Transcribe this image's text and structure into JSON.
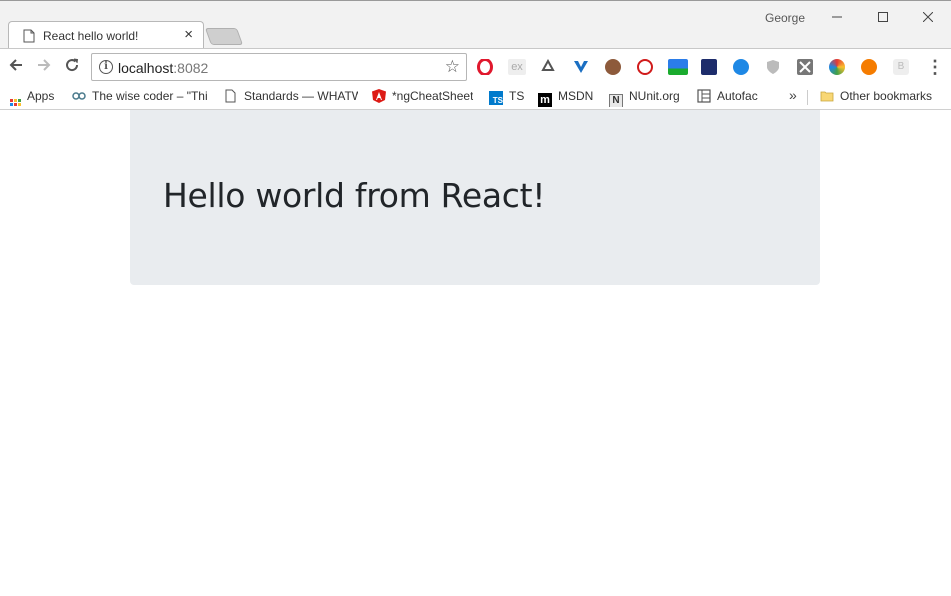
{
  "window": {
    "user_name": "George",
    "minimize": "—",
    "maximize": "☐",
    "close": "✕"
  },
  "tab": {
    "title": "React hello world!",
    "close": "×"
  },
  "toolbar": {
    "back": "←",
    "forward": "→",
    "reload": "⟳",
    "url_host": "localhost",
    "url_port": ":8082",
    "info": "i",
    "star": "☆",
    "menu": "⋮"
  },
  "bookmarks": {
    "items": [
      {
        "label": "Apps",
        "icon": "apps-grid-icon"
      },
      {
        "label": "The wise coder – \"Thi",
        "icon": "owl-icon"
      },
      {
        "label": "Standards — WHATW",
        "icon": "page-icon"
      },
      {
        "label": "*ngCheatSheet",
        "icon": "angular-icon"
      },
      {
        "label": "TS",
        "icon": "typescript-icon"
      },
      {
        "label": "MSDN",
        "icon": "msdn-icon"
      },
      {
        "label": "NUnit.org",
        "icon": "nunit-icon"
      },
      {
        "label": "Autofac",
        "icon": "autofac-icon"
      }
    ],
    "overflow": "»",
    "other": "Other bookmarks"
  },
  "page": {
    "heading": "Hello world from React!"
  },
  "colors": {
    "jumbotron_bg": "#e9ecef",
    "heading": "#212529"
  },
  "extensions": [
    "opera-icon",
    "ex-icon",
    "recycle-icon",
    "vuejs-devtools-icon",
    "cookie-icon",
    "no-sync-icon",
    "beta-ext-icon",
    "speed-icon",
    "edge-icon",
    "shield-icon",
    "x-ext-icon",
    "color-picker-icon",
    "lifebuoy-icon",
    "b-ext-icon"
  ]
}
